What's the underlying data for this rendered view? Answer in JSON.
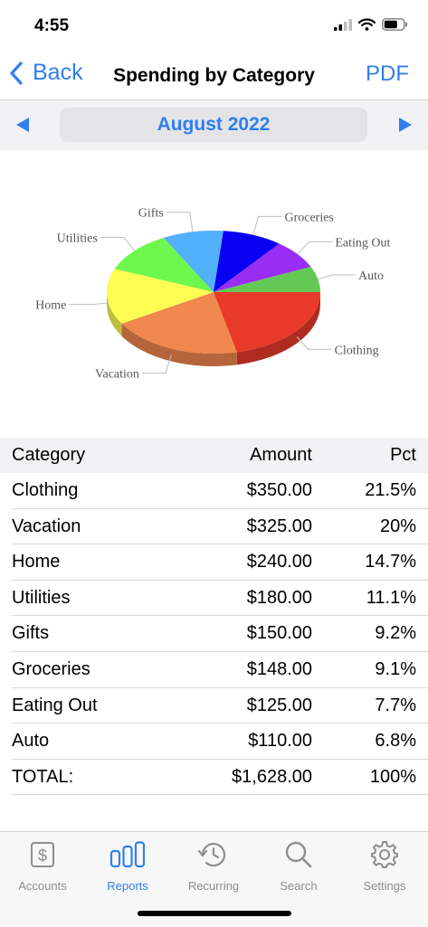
{
  "status": {
    "time": "4:55"
  },
  "nav": {
    "back_label": "Back",
    "title": "Spending by Category",
    "pdf_label": "PDF"
  },
  "month": {
    "label": "August 2022"
  },
  "colors": {
    "accent": "#2f7ff0",
    "inactive": "#8e8e93"
  },
  "chart_data": {
    "type": "pie",
    "title": "",
    "slices": [
      {
        "label": "Clothing",
        "value": 350,
        "color": "#e8392a"
      },
      {
        "label": "Vacation",
        "value": 325,
        "color": "#f0874e"
      },
      {
        "label": "Home",
        "value": 240,
        "color": "#fdfd52"
      },
      {
        "label": "Utilities",
        "value": 180,
        "color": "#6ef74c"
      },
      {
        "label": "Gifts",
        "value": 150,
        "color": "#53b0fb"
      },
      {
        "label": "Groceries",
        "value": 148,
        "color": "#0a00f1"
      },
      {
        "label": "Eating Out",
        "value": 125,
        "color": "#9a2df5"
      },
      {
        "label": "Auto",
        "value": 110,
        "color": "#64c854"
      }
    ]
  },
  "table": {
    "headers": {
      "category": "Category",
      "amount": "Amount",
      "pct": "Pct"
    },
    "rows": [
      {
        "category": "Clothing",
        "amount": "$350.00",
        "pct": "21.5%"
      },
      {
        "category": "Vacation",
        "amount": "$325.00",
        "pct": "20%"
      },
      {
        "category": "Home",
        "amount": "$240.00",
        "pct": "14.7%"
      },
      {
        "category": "Utilities",
        "amount": "$180.00",
        "pct": "11.1%"
      },
      {
        "category": "Gifts",
        "amount": "$150.00",
        "pct": "9.2%"
      },
      {
        "category": "Groceries",
        "amount": "$148.00",
        "pct": "9.1%"
      },
      {
        "category": "Eating Out",
        "amount": "$125.00",
        "pct": "7.7%"
      },
      {
        "category": "Auto",
        "amount": "$110.00",
        "pct": "6.8%"
      },
      {
        "category": "TOTAL:",
        "amount": "$1,628.00",
        "pct": "100%"
      }
    ]
  },
  "tabs": [
    {
      "label": "Accounts",
      "icon": "dollar-bill-icon",
      "active": false
    },
    {
      "label": "Reports",
      "icon": "bar-chart-icon",
      "active": true
    },
    {
      "label": "Recurring",
      "icon": "clock-arrows-icon",
      "active": false
    },
    {
      "label": "Search",
      "icon": "magnifier-icon",
      "active": false
    },
    {
      "label": "Settings",
      "icon": "gear-icon",
      "active": false
    }
  ]
}
